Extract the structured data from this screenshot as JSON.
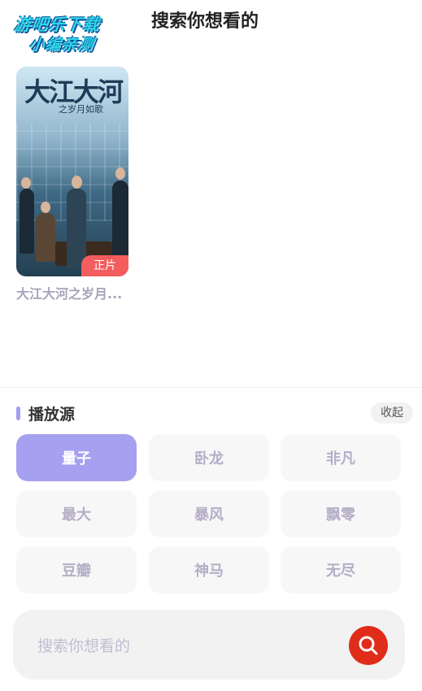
{
  "watermark": {
    "line1": "游吧乐下载",
    "line2": "小编亲测"
  },
  "header": {
    "title": "搜索你想看的"
  },
  "results": [
    {
      "poster_title": "大江大河",
      "poster_subtitle": "之岁月如歌",
      "badge": "正片",
      "title": "大江大河之岁月..."
    }
  ],
  "sources": {
    "title": "播放源",
    "collapse_label": "收起",
    "items": [
      "量子",
      "卧龙",
      "非凡",
      "最大",
      "暴风",
      "飘零",
      "豆瓣",
      "神马",
      "无尽"
    ],
    "selected": "量子"
  },
  "search": {
    "placeholder": "搜索你想看的",
    "icon": "search-icon"
  },
  "colors": {
    "accent": "#a5a0ef",
    "badge": "#f45d5d",
    "search_button": "#e02d1a"
  }
}
